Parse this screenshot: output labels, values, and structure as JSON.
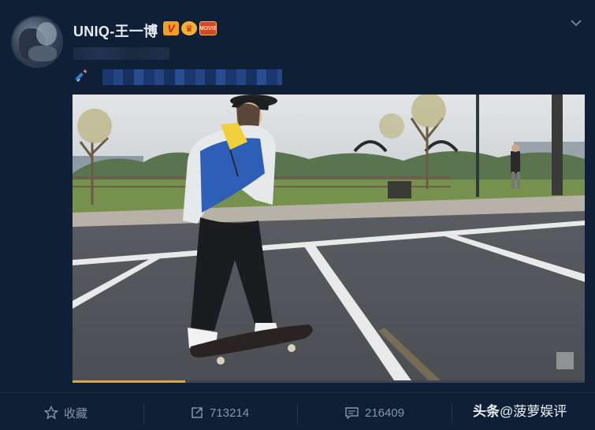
{
  "post": {
    "username": "UNIQ-王一博",
    "badges": [
      {
        "name": "verified-v-badge",
        "text": "V"
      },
      {
        "name": "crown-badge",
        "text": "♛"
      },
      {
        "name": "movie-badge",
        "text": "MOVIE"
      }
    ]
  },
  "video": {
    "progress": 0.22
  },
  "actions": {
    "favorite_label": "收藏",
    "repost_count": "713214",
    "comment_count": "216409"
  },
  "watermark": {
    "brand": "头条",
    "handle": "@菠萝娱评"
  },
  "colors": {
    "background": "#0f1f36",
    "accent_progress": "#f2a31a",
    "muted_text": "#8796ad"
  }
}
